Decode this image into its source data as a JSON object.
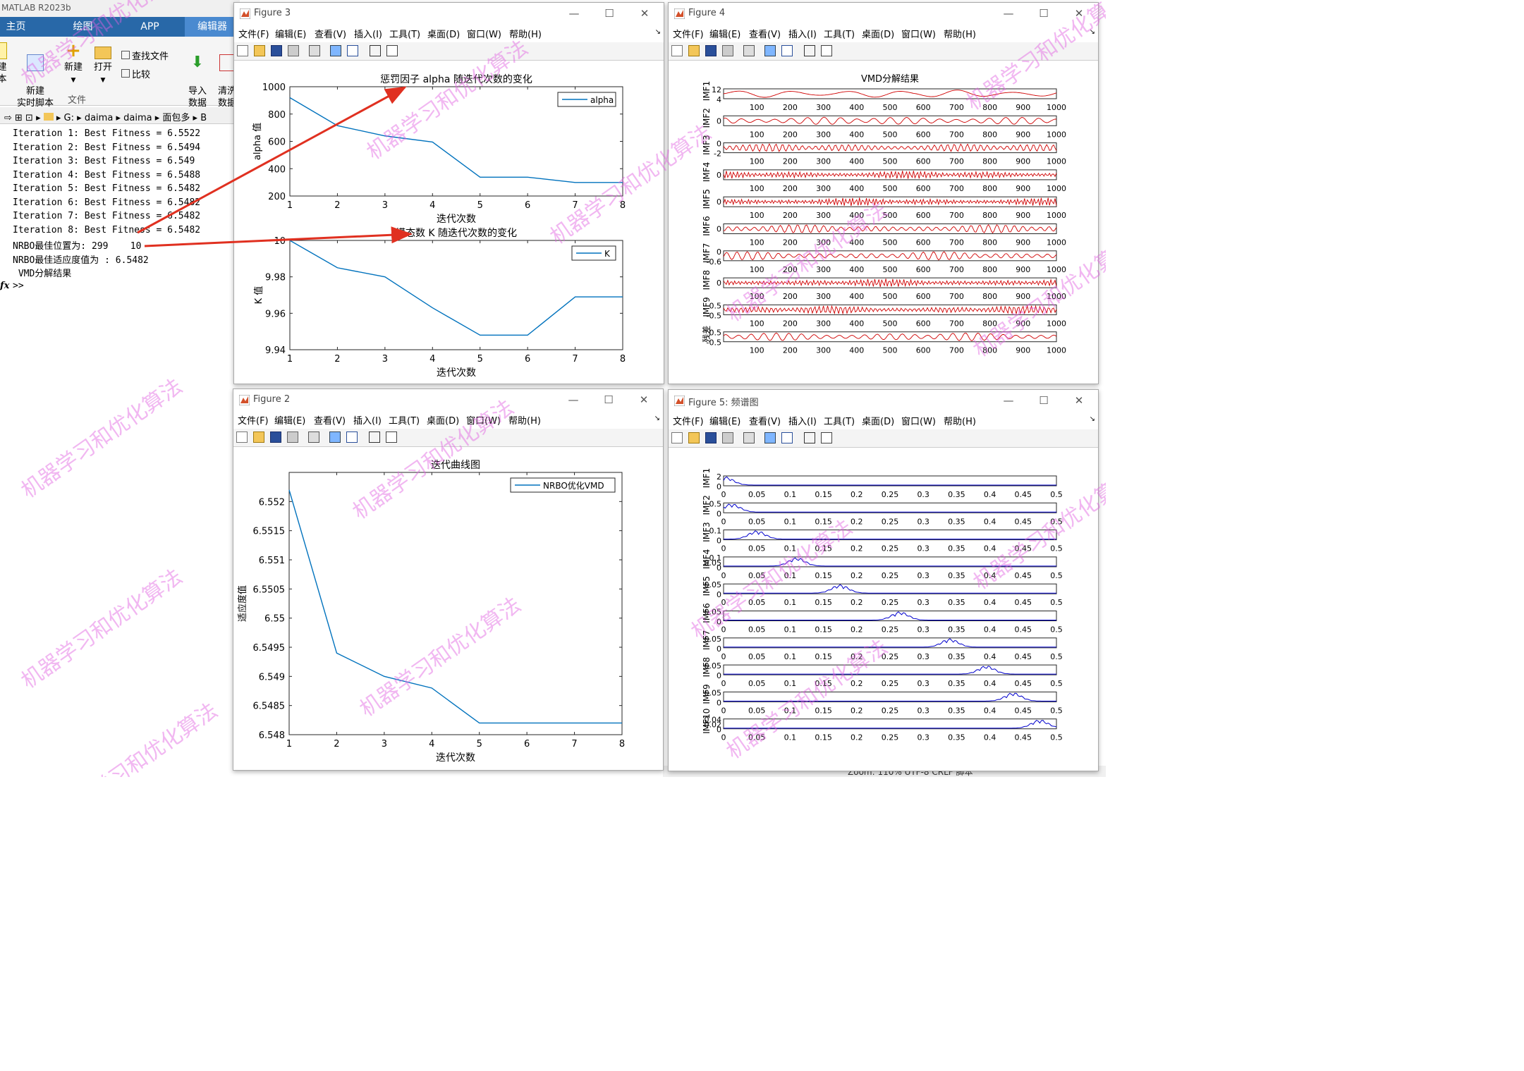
{
  "matlab": {
    "title": "MATLAB R2023b",
    "tabs": [
      "主页",
      "绘图",
      "APP",
      "编辑器"
    ],
    "ribbon": {
      "new_script": "本",
      "new_script_top": "建",
      "new_live": "新建\n实时脚本",
      "new": "新建",
      "open": "打开",
      "find_files": "查找文件",
      "compare": "比较",
      "import": "导入\n数据",
      "clean": "清洗\n数据",
      "section_file": "文件"
    },
    "address": [
      "G:",
      "daima",
      "daima",
      "面包多",
      "B"
    ],
    "command_lines": [
      "Iteration 1: Best Fitness = 6.5522",
      "Iteration 2: Best Fitness = 6.5494",
      "Iteration 3: Best Fitness = 6.549",
      "Iteration 4: Best Fitness = 6.5488",
      "Iteration 5: Best Fitness = 6.5482",
      "Iteration 6: Best Fitness = 6.5482",
      "Iteration 7: Best Fitness = 6.5482",
      "Iteration 8: Best Fitness = 6.5482",
      "NRBO最佳位置为: 299    10",
      "NRBO最佳适应度值为 : 6.5482",
      " VMD分解结果"
    ],
    "prompt": ">>",
    "fx": "fx",
    "status": "Zoom: 110%   UTF-8                 CRLF         脚本"
  },
  "menu": [
    "文件(F)",
    "编辑(E)",
    "查看(V)",
    "插入(I)",
    "工具(T)",
    "桌面(D)",
    "窗口(W)",
    "帮助(H)"
  ],
  "figure3": {
    "title": "Figure 3",
    "chart_data": [
      {
        "type": "line",
        "title": "惩罚因子 alpha 随迭代次数的变化",
        "xlabel": "迭代次数",
        "ylabel": "alpha 值",
        "x": [
          1,
          2,
          3,
          4,
          5,
          6,
          7,
          8
        ],
        "series": [
          {
            "name": "alpha",
            "values": [
              920,
              715,
              640,
              595,
              338,
              338,
              299,
              299
            ]
          }
        ],
        "xlim": [
          1,
          8
        ],
        "ylim": [
          200,
          1000
        ],
        "yticks": [
          200,
          400,
          600,
          800,
          1000
        ],
        "legend": "top-right",
        "color": "#0072bd"
      },
      {
        "type": "line",
        "title": "模态数 K 随迭代次数的变化",
        "xlabel": "迭代次数",
        "ylabel": "K 值",
        "x": [
          1,
          2,
          3,
          4,
          5,
          6,
          7,
          8
        ],
        "series": [
          {
            "name": "K",
            "values": [
              10,
              9.985,
              9.98,
              9.963,
              9.948,
              9.948,
              9.969,
              9.969
            ]
          }
        ],
        "xlim": [
          1,
          8
        ],
        "ylim": [
          9.94,
          10
        ],
        "yticks": [
          9.94,
          9.96,
          9.98,
          10
        ],
        "legend": "top-right",
        "color": "#0072bd"
      }
    ]
  },
  "figure4": {
    "title": "Figure 4",
    "chart_data": {
      "type": "line",
      "title": "VMD分解结果",
      "color": "#d00000",
      "xlim": [
        0,
        1000
      ],
      "xticks": [
        100,
        200,
        300,
        400,
        500,
        600,
        700,
        800,
        900,
        1000
      ],
      "panels": [
        {
          "label": "IMF1",
          "yticks": [
            "12",
            "4"
          ]
        },
        {
          "label": "IMF2",
          "yticks": [
            "0"
          ]
        },
        {
          "label": "IMF3",
          "yticks": [
            "0",
            "-2"
          ]
        },
        {
          "label": "IMF4",
          "yticks": [
            "0"
          ]
        },
        {
          "label": "IMF5",
          "yticks": [
            "0"
          ]
        },
        {
          "label": "IMF6",
          "yticks": [
            "0"
          ]
        },
        {
          "label": "IMF7",
          "yticks": [
            "0",
            "-0.6"
          ]
        },
        {
          "label": "IMF8",
          "yticks": [
            "0"
          ]
        },
        {
          "label": "IMF9",
          "yticks": [
            "0.5",
            "-0.5"
          ]
        },
        {
          "label": "残差",
          "yticks": [
            "0.5",
            "-0.5"
          ]
        }
      ]
    }
  },
  "figure2": {
    "title": "Figure 2",
    "chart_data": {
      "type": "line",
      "title": "迭代曲线图",
      "xlabel": "迭代次数",
      "ylabel": "适应度值",
      "x": [
        1,
        2,
        3,
        4,
        5,
        6,
        7,
        8
      ],
      "series": [
        {
          "name": "NRBO优化VMD",
          "values": [
            6.5522,
            6.5494,
            6.549,
            6.5488,
            6.5482,
            6.5482,
            6.5482,
            6.5482
          ]
        }
      ],
      "xlim": [
        1,
        8
      ],
      "ylim": [
        6.548,
        6.5525
      ],
      "yticks": [
        6.548,
        6.5485,
        6.549,
        6.5495,
        6.55,
        6.5505,
        6.551,
        6.5515,
        6.552
      ],
      "legend": "top-right",
      "color": "#0072bd"
    }
  },
  "figure5": {
    "title": "Figure 5: 频谱图",
    "chart_data": {
      "type": "line",
      "color": "#0000cc",
      "xlim": [
        0,
        0.5
      ],
      "xticks": [
        "0",
        "0.05",
        "0.1",
        "0.15",
        "0.2",
        "0.25",
        "0.3",
        "0.35",
        "0.4",
        "0.45",
        "0.5"
      ],
      "panels": [
        {
          "label": "IMF1",
          "yticks": [
            "2",
            "0"
          ],
          "peak": 0.002
        },
        {
          "label": "IMF2",
          "yticks": [
            "0.5",
            "0"
          ],
          "peak": 0.012
        },
        {
          "label": "IMF3",
          "yticks": [
            "0.1",
            "0"
          ],
          "peak": 0.05
        },
        {
          "label": "IMF4",
          "yticks": [
            "0.1",
            "0.05",
            "0"
          ],
          "peak": 0.11
        },
        {
          "label": "IMF5",
          "yticks": [
            "0.05",
            "0"
          ],
          "peak": 0.175
        },
        {
          "label": "IMF6",
          "yticks": [
            "0.05",
            "0"
          ],
          "peak": 0.265
        },
        {
          "label": "IMF7",
          "yticks": [
            "0.05",
            "0"
          ],
          "peak": 0.34
        },
        {
          "label": "IMF8",
          "yticks": [
            "0.05",
            "0"
          ],
          "peak": 0.395
        },
        {
          "label": "IMF9",
          "yticks": [
            "0.05",
            "0"
          ],
          "peak": 0.435
        },
        {
          "label": "IMF10",
          "yticks": [
            "0.04",
            "0.02",
            "0"
          ],
          "peak": 0.475
        }
      ]
    }
  },
  "watermark": "机器学习和优化算法"
}
